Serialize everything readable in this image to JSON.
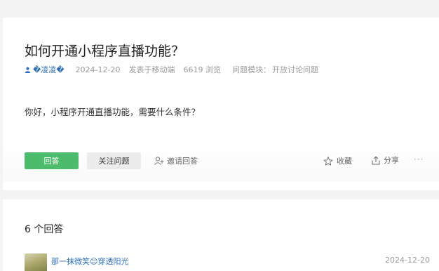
{
  "question": {
    "title": "如何开通小程序直播功能？",
    "author": "�凌凌�",
    "date": "2024-12-20",
    "source": "发表于移动端",
    "views": "6619 浏览",
    "module": "问题模块：",
    "module_value": "开放讨论问题",
    "body": "你好，小程序开通直播功能，需要什么条件？"
  },
  "actions": {
    "answer": "回答",
    "follow": "关注问题",
    "invite": "邀请回答",
    "favorite": "收藏",
    "share": "分享",
    "more": "···"
  },
  "answers": {
    "count_label": "6 个回答",
    "items": [
      {
        "author": "那一抹微笑😊穿透阳光",
        "date": "2024-12-20"
      }
    ]
  }
}
